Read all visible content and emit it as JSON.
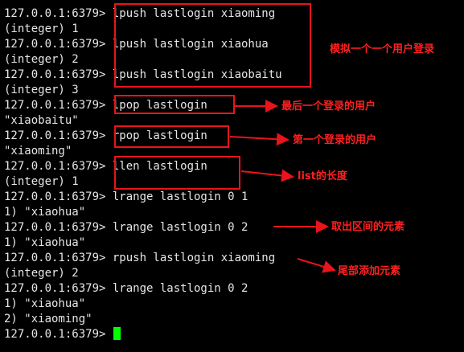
{
  "terminal": {
    "lines": [
      {
        "prompt": "127.0.0.1:6379> ",
        "cmd": "lpush lastlogin xiaoming"
      },
      {
        "text": "(integer) 1"
      },
      {
        "prompt": "127.0.0.1:6379> ",
        "cmd": "lpush lastlogin xiaohua"
      },
      {
        "text": "(integer) 2"
      },
      {
        "prompt": "127.0.0.1:6379> ",
        "cmd": "lpush lastlogin xiaobaitu"
      },
      {
        "text": "(integer) 3"
      },
      {
        "prompt": "127.0.0.1:6379> ",
        "cmd": "lpop lastlogin"
      },
      {
        "text": "\"xiaobaitu\""
      },
      {
        "prompt": "127.0.0.1:6379> ",
        "cmd": "rpop lastlogin"
      },
      {
        "text": "\"xiaoming\""
      },
      {
        "prompt": "127.0.0.1:6379> ",
        "cmd": "llen lastlogin"
      },
      {
        "text": "(integer) 1"
      },
      {
        "prompt": "127.0.0.1:6379> ",
        "cmd": "lrange lastlogin 0 1"
      },
      {
        "text": "1) \"xiaohua\""
      },
      {
        "prompt": "127.0.0.1:6379> ",
        "cmd": "lrange lastlogin 0 2"
      },
      {
        "text": "1) \"xiaohua\""
      },
      {
        "prompt": "127.0.0.1:6379> ",
        "cmd": "rpush lastlogin xiaoming"
      },
      {
        "text": "(integer) 2"
      },
      {
        "prompt": "127.0.0.1:6379> ",
        "cmd": "lrange lastlogin 0 2"
      },
      {
        "text": "1) \"xiaohua\""
      },
      {
        "text": "2) \"xiaoming\""
      },
      {
        "prompt": "127.0.0.1:6379> ",
        "cmd": ""
      }
    ]
  },
  "annotations": {
    "simulate_login": "模拟一个一个用户登录",
    "last_login_user": "最后一个登录的用户",
    "first_login_user": "第一个登录的用户",
    "list_length": "list的长度",
    "range_elements": "取出区间的元素",
    "tail_add_element": "尾部添加元素"
  },
  "colors": {
    "background": "#000000",
    "text": "#e6e6e6",
    "annotation": "#e8141b",
    "cursor": "#00ff00"
  }
}
